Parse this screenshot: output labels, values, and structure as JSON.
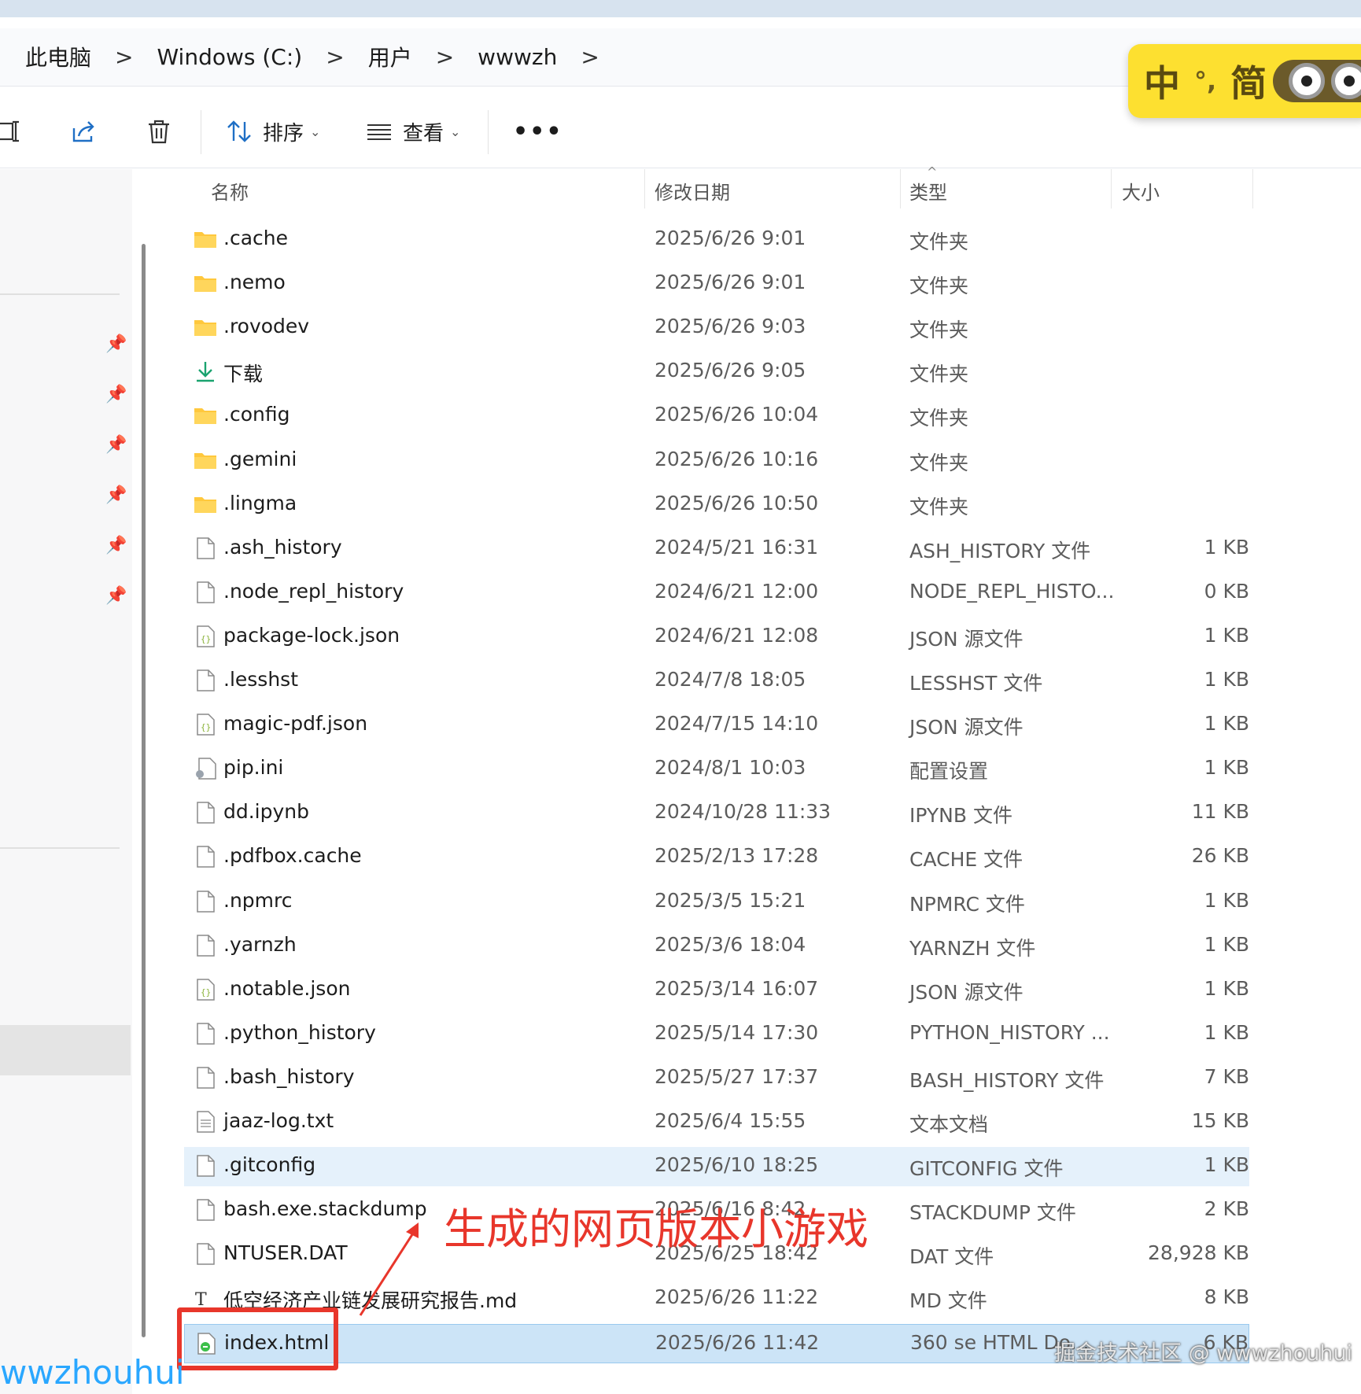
{
  "breadcrumb": {
    "items": [
      "此电脑",
      "Windows (C:)",
      "用户",
      "wwwzh"
    ],
    "separator": ">"
  },
  "ime": {
    "lang": "中",
    "punct": "°,",
    "mode": "简"
  },
  "toolbar": {
    "sort_label": "排序",
    "view_label": "查看",
    "more_label": "•••"
  },
  "columns": {
    "name": "名称",
    "date": "修改日期",
    "type": "类型",
    "size": "大小"
  },
  "files": [
    {
      "name": ".cache",
      "date": "2025/6/26 9:01",
      "type": "文件夹",
      "size": "",
      "icon": "folder"
    },
    {
      "name": ".nemo",
      "date": "2025/6/26 9:01",
      "type": "文件夹",
      "size": "",
      "icon": "folder"
    },
    {
      "name": ".rovodev",
      "date": "2025/6/26 9:03",
      "type": "文件夹",
      "size": "",
      "icon": "folder"
    },
    {
      "name": "下载",
      "date": "2025/6/26 9:05",
      "type": "文件夹",
      "size": "",
      "icon": "download"
    },
    {
      "name": ".config",
      "date": "2025/6/26 10:04",
      "type": "文件夹",
      "size": "",
      "icon": "folder"
    },
    {
      "name": ".gemini",
      "date": "2025/6/26 10:16",
      "type": "文件夹",
      "size": "",
      "icon": "folder"
    },
    {
      "name": ".lingma",
      "date": "2025/6/26 10:50",
      "type": "文件夹",
      "size": "",
      "icon": "folder"
    },
    {
      "name": ".ash_history",
      "date": "2024/5/21 16:31",
      "type": "ASH_HISTORY 文件",
      "size": "1 KB",
      "icon": "file"
    },
    {
      "name": ".node_repl_history",
      "date": "2024/6/21 12:00",
      "type": "NODE_REPL_HISTO...",
      "size": "0 KB",
      "icon": "file"
    },
    {
      "name": "package-lock.json",
      "date": "2024/6/21 12:08",
      "type": "JSON 源文件",
      "size": "1 KB",
      "icon": "json"
    },
    {
      "name": ".lesshst",
      "date": "2024/7/8 18:05",
      "type": "LESSHST 文件",
      "size": "1 KB",
      "icon": "file"
    },
    {
      "name": "magic-pdf.json",
      "date": "2024/7/15 14:10",
      "type": "JSON 源文件",
      "size": "1 KB",
      "icon": "json"
    },
    {
      "name": "pip.ini",
      "date": "2024/8/1 10:03",
      "type": "配置设置",
      "size": "1 KB",
      "icon": "ini"
    },
    {
      "name": "dd.ipynb",
      "date": "2024/10/28 11:33",
      "type": "IPYNB 文件",
      "size": "11 KB",
      "icon": "file"
    },
    {
      "name": ".pdfbox.cache",
      "date": "2025/2/13 17:28",
      "type": "CACHE 文件",
      "size": "26 KB",
      "icon": "file"
    },
    {
      "name": ".npmrc",
      "date": "2025/3/5 15:21",
      "type": "NPMRC 文件",
      "size": "1 KB",
      "icon": "file"
    },
    {
      "name": ".yarnzh",
      "date": "2025/3/6 18:04",
      "type": "YARNZH 文件",
      "size": "1 KB",
      "icon": "file"
    },
    {
      "name": ".notable.json",
      "date": "2025/3/14 16:07",
      "type": "JSON 源文件",
      "size": "1 KB",
      "icon": "json"
    },
    {
      "name": ".python_history",
      "date": "2025/5/14 17:30",
      "type": "PYTHON_HISTORY ...",
      "size": "1 KB",
      "icon": "file"
    },
    {
      "name": ".bash_history",
      "date": "2025/5/27 17:37",
      "type": "BASH_HISTORY 文件",
      "size": "7 KB",
      "icon": "file"
    },
    {
      "name": "jaaz-log.txt",
      "date": "2025/6/4 15:55",
      "type": "文本文档",
      "size": "15 KB",
      "icon": "txt"
    },
    {
      "name": ".gitconfig",
      "date": "2025/6/10 18:25",
      "type": "GITCONFIG 文件",
      "size": "1 KB",
      "icon": "file",
      "state": "hover"
    },
    {
      "name": "bash.exe.stackdump",
      "date": "2025/6/16 8:42",
      "type": "STACKDUMP 文件",
      "size": "2 KB",
      "icon": "file"
    },
    {
      "name": "NTUSER.DAT",
      "date": "2025/6/25 18:42",
      "type": "DAT 文件",
      "size": "28,928 KB",
      "icon": "file"
    },
    {
      "name": "低空经济产业链发展研究报告.md",
      "date": "2025/6/26 11:22",
      "type": "MD 文件",
      "size": "8 KB",
      "icon": "md"
    },
    {
      "name": "index.html",
      "date": "2025/6/26 11:42",
      "type": "360 se HTML Do...",
      "size": "6 KB",
      "icon": "html",
      "state": "selected"
    }
  ],
  "annotation": {
    "text": "生成的网页版本小游戏"
  },
  "watermark": {
    "right": "掘金技术社区 @ wwwzhouhui",
    "left": "wwzhouhui"
  },
  "colors": {
    "accent_red": "#e8362b",
    "selection": "#cce4f7",
    "hover": "#e5f1fb",
    "folder": "#ffc83d",
    "ime_bg": "#fde030"
  }
}
